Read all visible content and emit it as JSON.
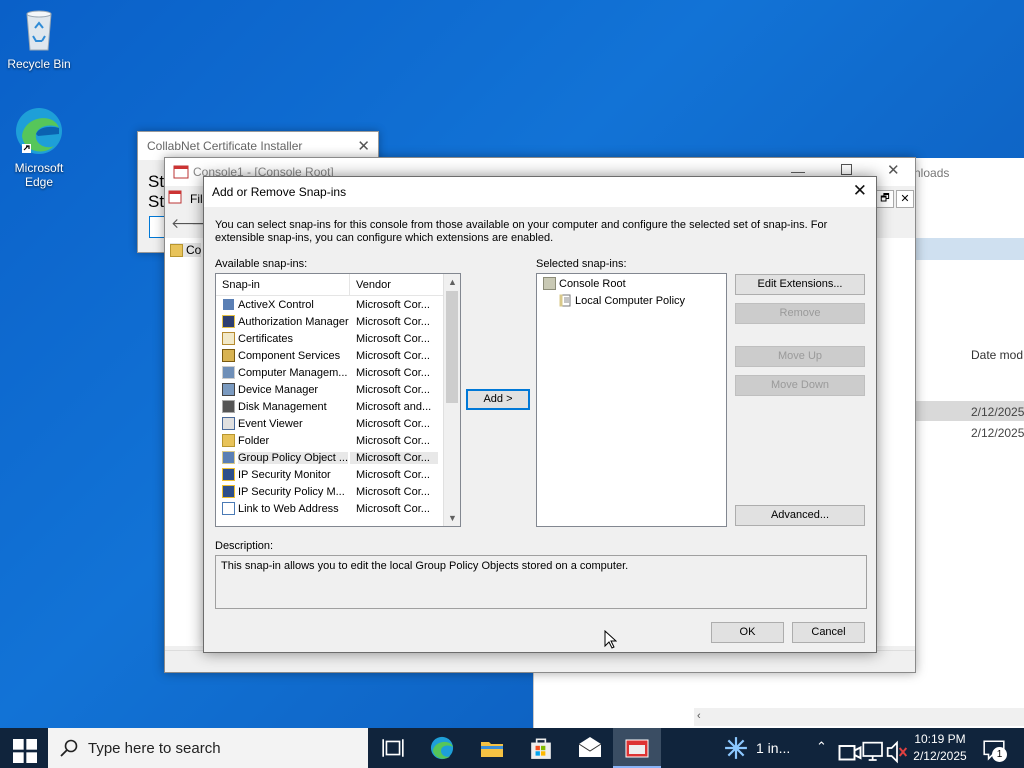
{
  "desktop": {
    "icons": [
      {
        "label": "Recycle Bin"
      },
      {
        "label": "Microsoft Edge"
      }
    ]
  },
  "collabnet": {
    "title": "CollabNet Certificate Installer",
    "partial_text_1": "St",
    "partial_text_2": "St"
  },
  "console": {
    "title": "Console1 - [Console Root]",
    "menu_file": "Fil",
    "tree_partial": "Co"
  },
  "explorer": {
    "title_partial": "nloads",
    "col_date_modified": "Date mod",
    "dates": [
      "2/12/2025",
      "2/12/2025"
    ]
  },
  "dialog": {
    "title": "Add or Remove Snap-ins",
    "intro": "You can select snap-ins for this console from those available on your computer and configure the selected set of snap-ins. For extensible snap-ins, you can configure which extensions are enabled.",
    "available_label": "Available snap-ins:",
    "selected_label": "Selected snap-ins:",
    "col_snapin": "Snap-in",
    "col_vendor": "Vendor",
    "snapins": [
      {
        "name": "ActiveX Control",
        "vendor": "Microsoft Cor...",
        "icon": "activex-icon"
      },
      {
        "name": "Authorization Manager",
        "vendor": "Microsoft Cor...",
        "icon": "authorization-icon"
      },
      {
        "name": "Certificates",
        "vendor": "Microsoft Cor...",
        "icon": "certificate-icon"
      },
      {
        "name": "Component Services",
        "vendor": "Microsoft Cor...",
        "icon": "component-icon"
      },
      {
        "name": "Computer Managem...",
        "vendor": "Microsoft Cor...",
        "icon": "computer-management-icon"
      },
      {
        "name": "Device Manager",
        "vendor": "Microsoft Cor...",
        "icon": "device-manager-icon"
      },
      {
        "name": "Disk Management",
        "vendor": "Microsoft and...",
        "icon": "disk-icon"
      },
      {
        "name": "Event Viewer",
        "vendor": "Microsoft Cor...",
        "icon": "event-viewer-icon"
      },
      {
        "name": "Folder",
        "vendor": "Microsoft Cor...",
        "icon": "folder-icon"
      },
      {
        "name": "Group Policy Object ...",
        "vendor": "Microsoft Cor...",
        "icon": "group-policy-icon"
      },
      {
        "name": "IP Security Monitor",
        "vendor": "Microsoft Cor...",
        "icon": "ip-security-icon"
      },
      {
        "name": "IP Security Policy M...",
        "vendor": "Microsoft Cor...",
        "icon": "ip-security-icon"
      },
      {
        "name": "Link to Web Address",
        "vendor": "Microsoft Cor...",
        "icon": "web-link-icon"
      }
    ],
    "selected_tree": {
      "root": "Console Root",
      "child": "Local Computer Policy"
    },
    "add_button": "Add >",
    "edit_extensions": "Edit Extensions...",
    "remove": "Remove",
    "move_up": "Move Up",
    "move_down": "Move Down",
    "advanced": "Advanced...",
    "description_label": "Description:",
    "description": "This snap-in allows you to edit the local Group Policy Objects stored on a computer.",
    "ok": "OK",
    "cancel": "Cancel"
  },
  "taskbar": {
    "search_placeholder": "Type here to search",
    "weather_text": "1 in...",
    "time": "10:19 PM",
    "date": "2/12/2025",
    "notification_count": "1"
  }
}
